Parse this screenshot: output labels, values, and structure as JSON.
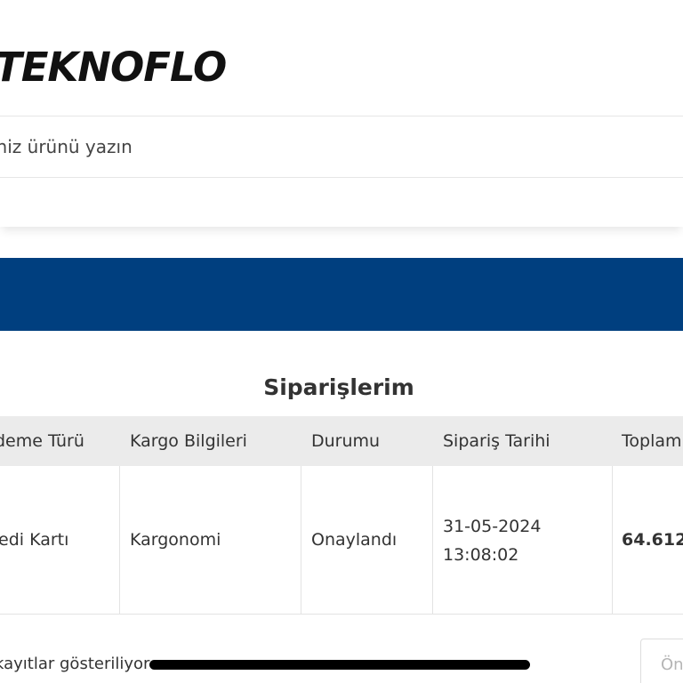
{
  "header": {
    "logo_text": "TEKNOFLO"
  },
  "search": {
    "placeholder": "iniz ürünü yazın"
  },
  "banner": {
    "color": "#003f7f"
  },
  "orders": {
    "title": "Siparişlerim",
    "columns": [
      "deme Türü",
      "Kargo Bilgileri",
      "Durumu",
      "Sipariş Tarihi",
      "Toplam"
    ],
    "rows": [
      {
        "payment_type": "edi Kartı",
        "cargo": "Kargonomi",
        "status": "Onaylandı",
        "date": "31-05-2024",
        "time": "13:08:02",
        "total": "64.612"
      }
    ]
  },
  "footer": {
    "records_info": "kayıtlar gösteriliyor",
    "prev_label": "Ön"
  }
}
